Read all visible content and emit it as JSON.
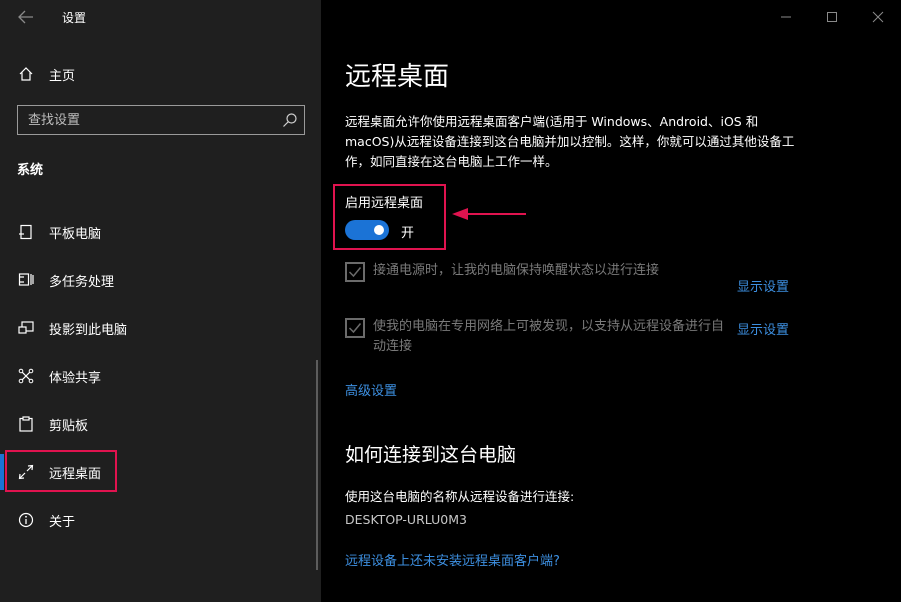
{
  "window": {
    "title": "设置",
    "controls": [
      "minimize-icon",
      "maximize-icon",
      "close-icon"
    ]
  },
  "sidebar": {
    "home_label": "主页",
    "search_placeholder": "查找设置",
    "section": "系统",
    "items": [
      {
        "label": "平板电脑",
        "icon": "tablet-icon"
      },
      {
        "label": "多任务处理",
        "icon": "multitasking-icon"
      },
      {
        "label": "投影到此电脑",
        "icon": "project-icon"
      },
      {
        "label": "体验共享",
        "icon": "share-icon"
      },
      {
        "label": "剪贴板",
        "icon": "clipboard-icon"
      },
      {
        "label": "远程桌面",
        "icon": "remote-desktop-icon",
        "selected": true
      },
      {
        "label": "关于",
        "icon": "info-icon"
      }
    ]
  },
  "main": {
    "title": "远程桌面",
    "description": "远程桌面允许你使用远程桌面客户端(适用于 Windows、Android、iOS 和 macOS)从远程设备连接到这台电脑并加以控制。这样，你就可以通过其他设备工作，如同直接在这台电脑上工作一样。",
    "toggle": {
      "label": "启用远程桌面",
      "state_text": "开",
      "on": true
    },
    "checkboxes": [
      {
        "text": "接通电源时，让我的电脑保持唤醒状态以进行连接",
        "checked": true,
        "link": "显示设置"
      },
      {
        "text": "使我的电脑在专用网络上可被发现，以支持从远程设备进行自动连接",
        "checked": true,
        "link": "显示设置"
      }
    ],
    "advanced_link": "高级设置",
    "how_heading": "如何连接到这台电脑",
    "how_desc": "使用这台电脑的名称从远程设备进行连接:",
    "pc_name": "DESKTOP-URLU0M3",
    "client_link": "远程设备上还未安装远程桌面客户端?"
  },
  "colors": {
    "accent": "#1b73d6",
    "highlight": "#e0134f",
    "link": "#3d8fe0"
  }
}
